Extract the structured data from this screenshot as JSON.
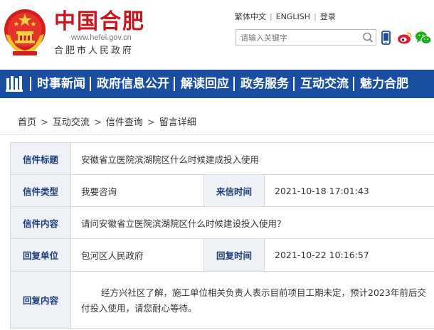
{
  "header": {
    "site_name": "中国合肥",
    "site_url": "www.hefei.gov.cn",
    "site_sub": "合肥市人民政府",
    "top_links": [
      "繁体中文",
      "ENGLISH",
      "登录"
    ],
    "top_link_sep": "|",
    "search_placeholder": "请输入关键字",
    "icons": [
      "emblem-icon",
      "search-icon",
      "phone-icon",
      "weibo-icon",
      "wechat-icon"
    ]
  },
  "nav": {
    "items": [
      "时事新闻",
      "政府信息公开",
      "解读回应",
      "政务服务",
      "互动交流",
      "魅力合肥"
    ]
  },
  "breadcrumb": {
    "items": [
      "首页",
      "互动交流",
      "信件查询",
      "留言详细"
    ],
    "sep": ">"
  },
  "detail": {
    "title_label": "信件标题",
    "title_value": "安徽省立医院滨湖院区什么时候建成投入使用",
    "type_label": "信件类型",
    "type_value": "我要咨询",
    "recv_time_label": "来信时间",
    "recv_time_value": "2021-10-18 17:01:43",
    "content_label": "信件内容",
    "content_value": "请问安徽省立医院滨湖院区什么时候建设投入使用？",
    "reply_unit_label": "回复单位",
    "reply_unit_value": "包河区人民政府",
    "reply_time_label": "回复时间",
    "reply_time_value": "2021-10-22 10:16:57",
    "reply_content_label": "回复内容",
    "reply_content_value": "经方兴社区了解，施工单位相关负责人表示目前项目工期未定，预计2023年前后交付投入使用，请您耐心等待。"
  },
  "colors": {
    "nav_bg": "#1a4ea0",
    "brand_red": "#c8171c",
    "label_bg": "#eef1f6",
    "label_text": "#1e3d7b"
  }
}
